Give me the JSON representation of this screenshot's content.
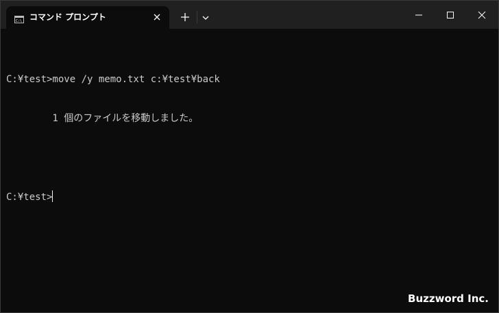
{
  "window": {
    "tab_title": "コマンド プロンプト",
    "icons": {
      "tab": "terminal-cmd-icon",
      "close_tab": "close-icon",
      "new_tab": "plus-icon",
      "dropdown": "chevron-down-icon",
      "minimize": "minimize-icon",
      "maximize": "maximize-icon",
      "close": "close-icon"
    }
  },
  "terminal": {
    "lines": [
      "C:¥test>move /y memo.txt c:¥test¥back",
      "        1 個のファイルを移動しました。",
      "",
      "C:¥test>"
    ]
  },
  "watermark": "Buzzword Inc.",
  "colors": {
    "background": "#0c0c0c",
    "titlebar": "#202020",
    "text": "#cccccc"
  }
}
